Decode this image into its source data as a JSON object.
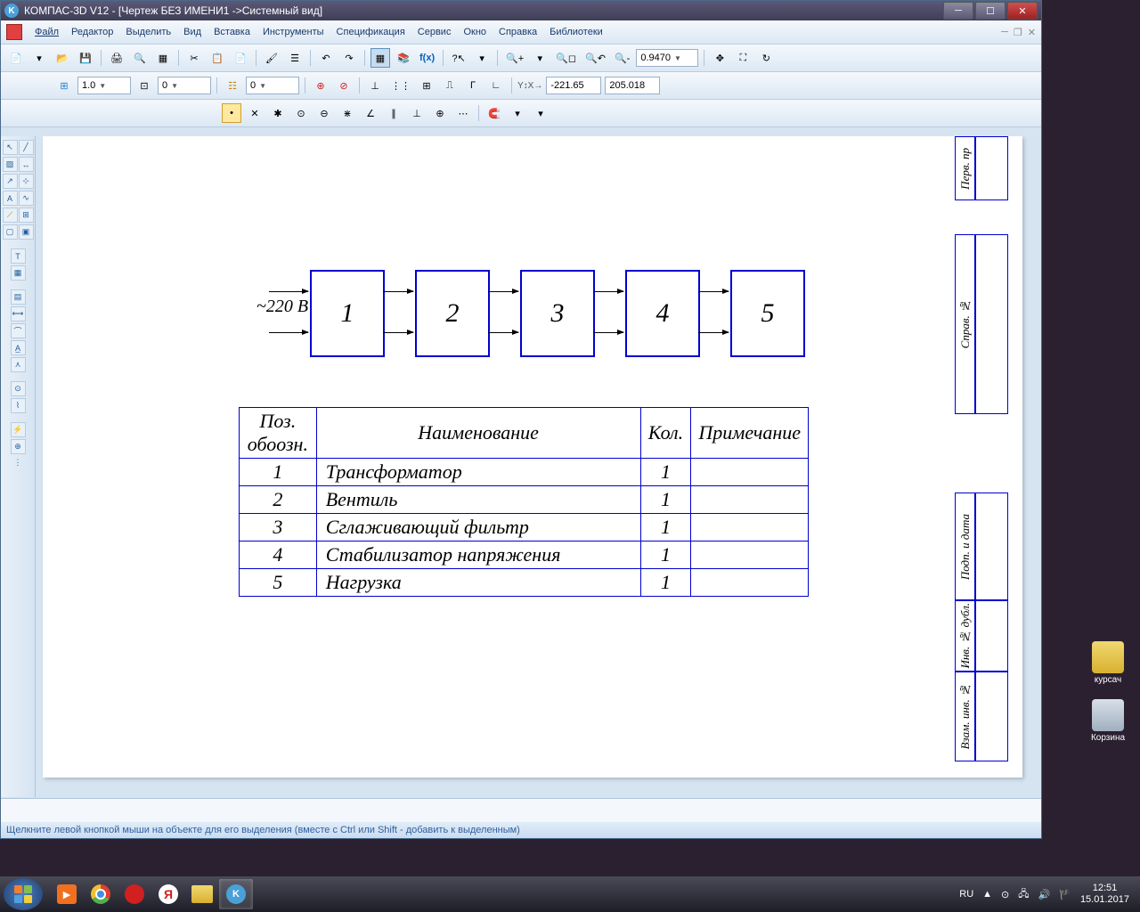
{
  "titlebar": {
    "text": "КОМПАС-3D V12 - [Чертеж БЕЗ ИМЕНИ1 ->Системный вид]"
  },
  "menu": {
    "file": "Файл",
    "editor": "Редактор",
    "select": "Выделить",
    "view": "Вид",
    "insert": "Вставка",
    "tools": "Инструменты",
    "spec": "Спецификация",
    "service": "Сервис",
    "window": "Окно",
    "help": "Справка",
    "libs": "Библиотеки"
  },
  "toolbar": {
    "zoom": "0.9470",
    "scale": "1.0",
    "offset": "0",
    "layer": "0",
    "coord_x": "-221.65",
    "coord_y": "205.018"
  },
  "drawing": {
    "voltage": "~220 В",
    "blocks": [
      "1",
      "2",
      "3",
      "4",
      "5"
    ],
    "table": {
      "headers": {
        "pos": "Поз. обоозн.",
        "name": "Наименование",
        "qty": "Кол.",
        "note": "Примечание"
      },
      "rows": [
        {
          "pos": "1",
          "name": "Трансформатор",
          "qty": "1",
          "note": ""
        },
        {
          "pos": "2",
          "name": "Вентиль",
          "qty": "1",
          "note": ""
        },
        {
          "pos": "3",
          "name": "Сглаживающий фильтр",
          "qty": "1",
          "note": ""
        },
        {
          "pos": "4",
          "name": "Стабилизатор напряжения",
          "qty": "1",
          "note": ""
        },
        {
          "pos": "5",
          "name": "Нагрузка",
          "qty": "1",
          "note": ""
        }
      ]
    },
    "frame": {
      "perv": "Перв. пр",
      "sprav": "Справ. №",
      "podp": "Подп. и дата",
      "inv": "Инв. № дубл.",
      "vzam": "Взам. инв. №"
    }
  },
  "status": {
    "text": "Щелкните левой кнопкой мыши на объекте для его выделения (вместе с Ctrl или Shift - добавить к выделенным)"
  },
  "desktop": {
    "folder": "курсач",
    "trash": "Корзина"
  },
  "tray": {
    "lang": "RU",
    "time": "12:51",
    "date": "15.01.2017"
  }
}
